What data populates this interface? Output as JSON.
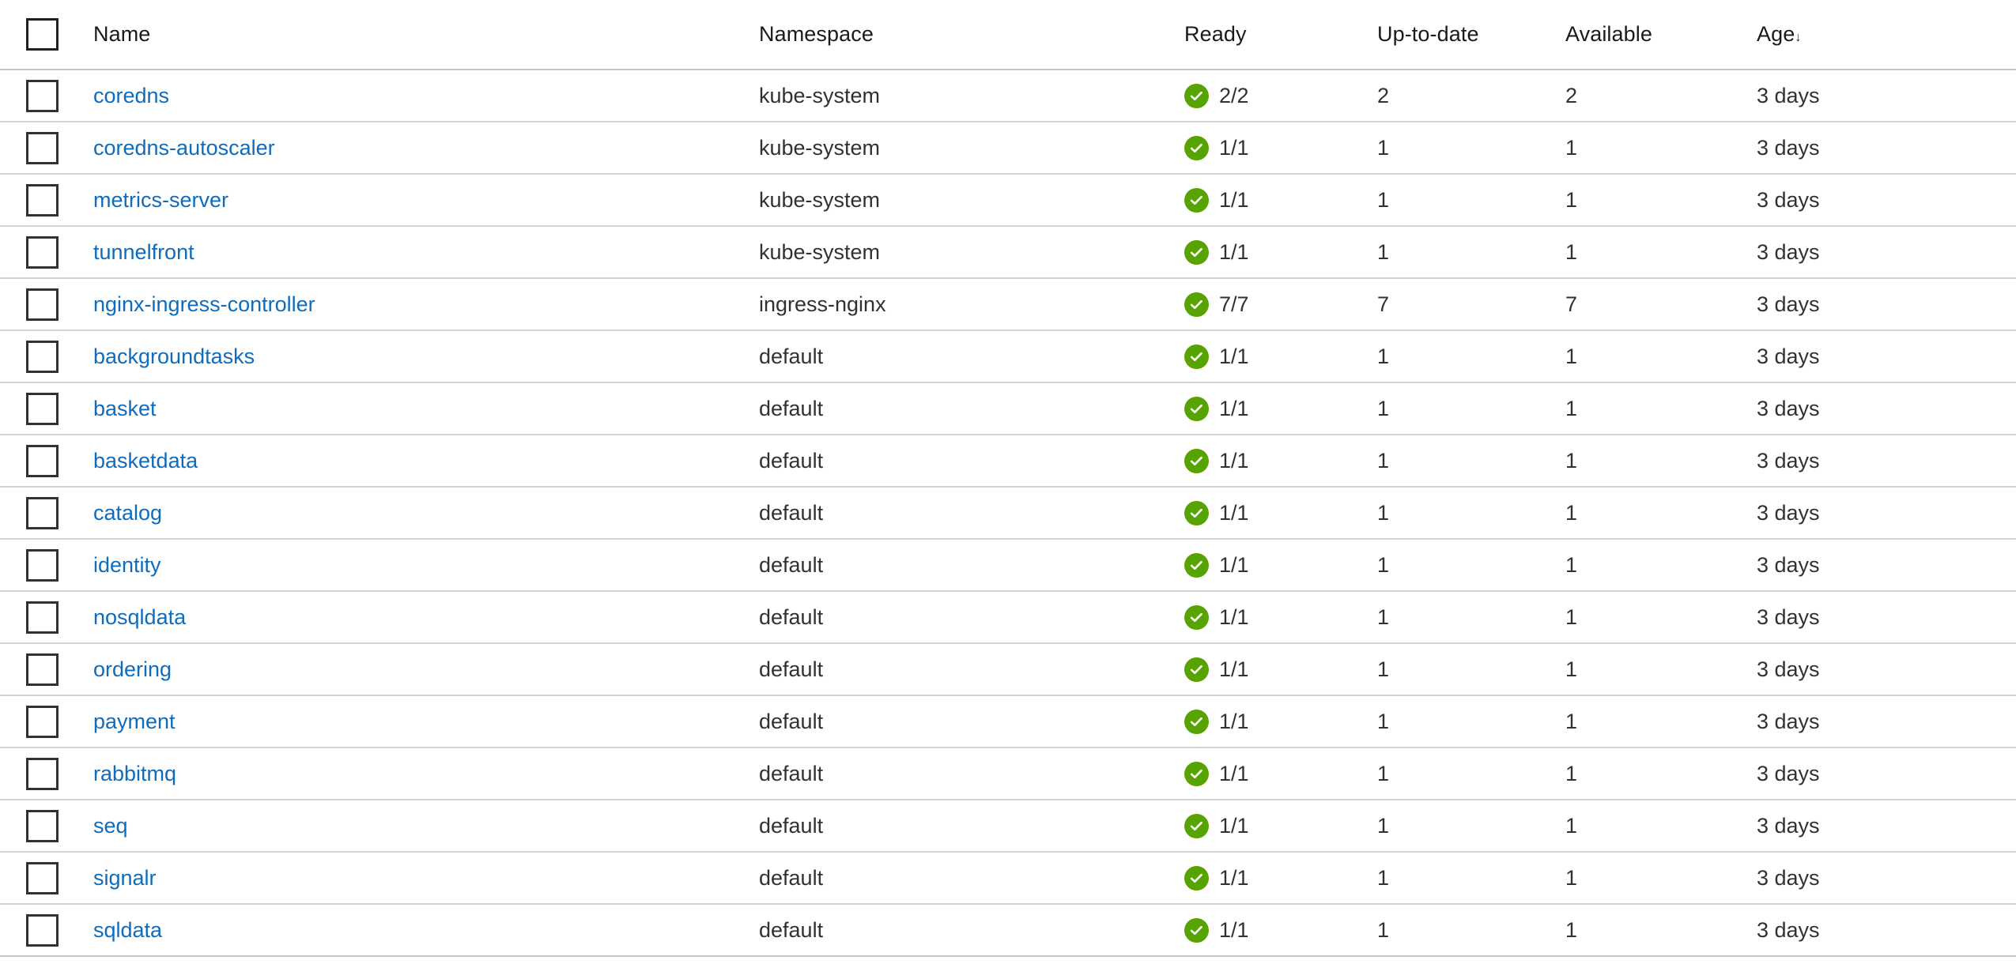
{
  "table": {
    "select_all_checkbox": "select-all",
    "columns": [
      {
        "key": "name",
        "label": "Name"
      },
      {
        "key": "namespace",
        "label": "Namespace"
      },
      {
        "key": "ready",
        "label": "Ready"
      },
      {
        "key": "uptodate",
        "label": "Up-to-date"
      },
      {
        "key": "available",
        "label": "Available"
      },
      {
        "key": "age",
        "label": "Age"
      }
    ],
    "sort": {
      "column": "age",
      "direction": "desc",
      "arrow_glyph": "↓"
    },
    "status_icon_name": "success-check-icon",
    "status_color": "#57a300",
    "link_color": "#0f6cbd",
    "rows": [
      {
        "name": "coredns",
        "namespace": "kube-system",
        "status": "success",
        "ready": "2/2",
        "uptodate": "2",
        "available": "2",
        "age": "3 days"
      },
      {
        "name": "coredns-autoscaler",
        "namespace": "kube-system",
        "status": "success",
        "ready": "1/1",
        "uptodate": "1",
        "available": "1",
        "age": "3 days"
      },
      {
        "name": "metrics-server",
        "namespace": "kube-system",
        "status": "success",
        "ready": "1/1",
        "uptodate": "1",
        "available": "1",
        "age": "3 days"
      },
      {
        "name": "tunnelfront",
        "namespace": "kube-system",
        "status": "success",
        "ready": "1/1",
        "uptodate": "1",
        "available": "1",
        "age": "3 days"
      },
      {
        "name": "nginx-ingress-controller",
        "namespace": "ingress-nginx",
        "status": "success",
        "ready": "7/7",
        "uptodate": "7",
        "available": "7",
        "age": "3 days"
      },
      {
        "name": "backgroundtasks",
        "namespace": "default",
        "status": "success",
        "ready": "1/1",
        "uptodate": "1",
        "available": "1",
        "age": "3 days"
      },
      {
        "name": "basket",
        "namespace": "default",
        "status": "success",
        "ready": "1/1",
        "uptodate": "1",
        "available": "1",
        "age": "3 days"
      },
      {
        "name": "basketdata",
        "namespace": "default",
        "status": "success",
        "ready": "1/1",
        "uptodate": "1",
        "available": "1",
        "age": "3 days"
      },
      {
        "name": "catalog",
        "namespace": "default",
        "status": "success",
        "ready": "1/1",
        "uptodate": "1",
        "available": "1",
        "age": "3 days"
      },
      {
        "name": "identity",
        "namespace": "default",
        "status": "success",
        "ready": "1/1",
        "uptodate": "1",
        "available": "1",
        "age": "3 days"
      },
      {
        "name": "nosqldata",
        "namespace": "default",
        "status": "success",
        "ready": "1/1",
        "uptodate": "1",
        "available": "1",
        "age": "3 days"
      },
      {
        "name": "ordering",
        "namespace": "default",
        "status": "success",
        "ready": "1/1",
        "uptodate": "1",
        "available": "1",
        "age": "3 days"
      },
      {
        "name": "payment",
        "namespace": "default",
        "status": "success",
        "ready": "1/1",
        "uptodate": "1",
        "available": "1",
        "age": "3 days"
      },
      {
        "name": "rabbitmq",
        "namespace": "default",
        "status": "success",
        "ready": "1/1",
        "uptodate": "1",
        "available": "1",
        "age": "3 days"
      },
      {
        "name": "seq",
        "namespace": "default",
        "status": "success",
        "ready": "1/1",
        "uptodate": "1",
        "available": "1",
        "age": "3 days"
      },
      {
        "name": "signalr",
        "namespace": "default",
        "status": "success",
        "ready": "1/1",
        "uptodate": "1",
        "available": "1",
        "age": "3 days"
      },
      {
        "name": "sqldata",
        "namespace": "default",
        "status": "success",
        "ready": "1/1",
        "uptodate": "1",
        "available": "1",
        "age": "3 days"
      }
    ]
  }
}
